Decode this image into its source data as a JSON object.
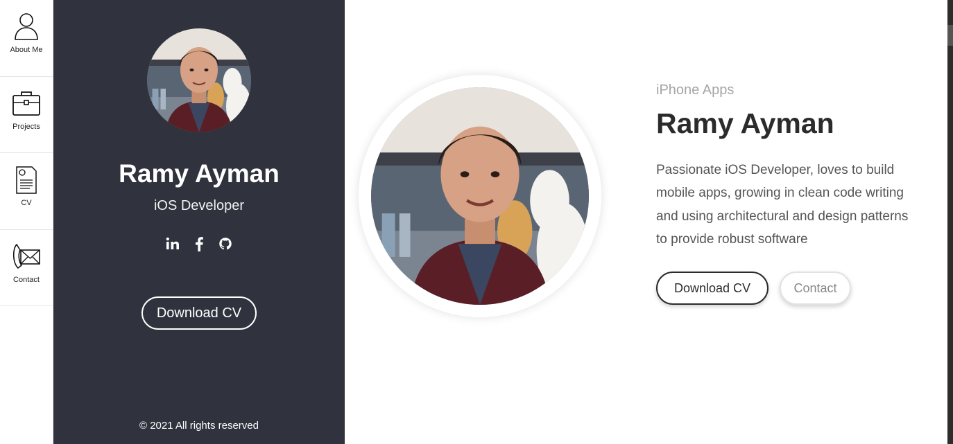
{
  "nav": {
    "items": [
      {
        "label": "About Me",
        "icon": "person-icon"
      },
      {
        "label": "Projects",
        "icon": "briefcase-icon"
      },
      {
        "label": "CV",
        "icon": "document-icon"
      },
      {
        "label": "Contact",
        "icon": "envelope-phone-icon"
      }
    ]
  },
  "profile": {
    "name": "Ramy Ayman",
    "role": "iOS Developer",
    "social": [
      "linkedin-icon",
      "facebook-icon",
      "github-icon"
    ],
    "download_label": "Download CV",
    "copyright": "© 2021 All rights reserved"
  },
  "main": {
    "subtitle": "iPhone Apps",
    "name": "Ramy Ayman",
    "bio": "Passionate iOS Developer, loves to build mobile apps, growing in clean code writing and using architectural and design patterns to provide robust software",
    "download_label": "Download CV",
    "contact_label": "Contact"
  },
  "colors": {
    "panel_bg": "#30333d",
    "text_dark": "#2b2b2b",
    "subtitle": "#a5a5a5"
  }
}
